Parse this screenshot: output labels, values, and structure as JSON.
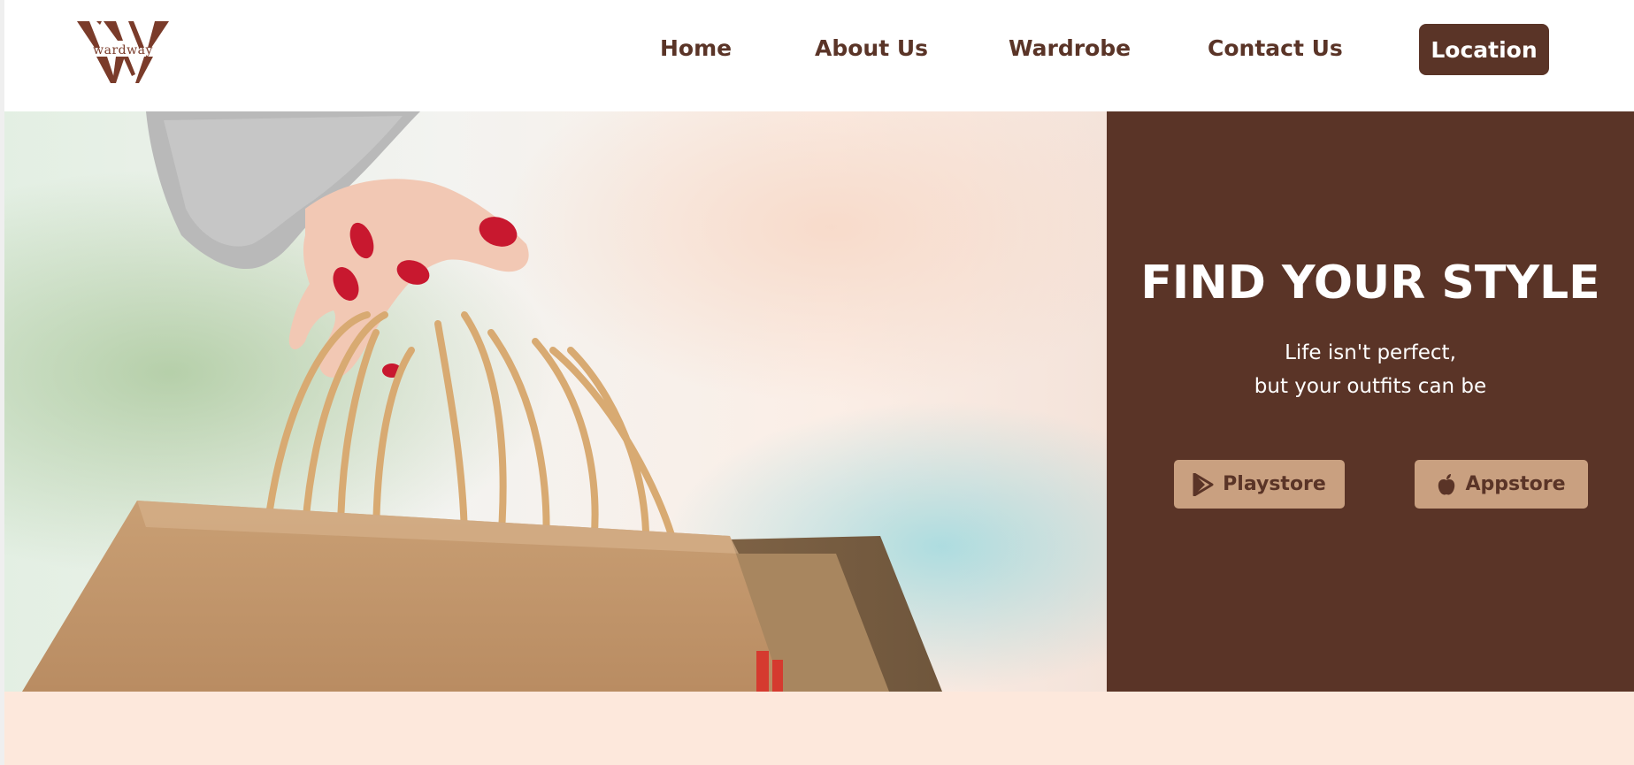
{
  "brand": {
    "logo_text": "wardway",
    "logo_icon": "double-w-logo-icon"
  },
  "nav": {
    "home": "Home",
    "about": "About Us",
    "wardrobe": "Wardrobe",
    "contact": "Contact Us",
    "location": "Location"
  },
  "hero": {
    "image_icon": "shopping-bags-image",
    "title": "FIND YOUR STYLE",
    "subtitle_line1": "Life isn't perfect,",
    "subtitle_line2": "but your outfits can be",
    "playstore_label": "Playstore",
    "appstore_label": "Appstore",
    "playstore_icon": "google-play-icon",
    "appstore_icon": "apple-icon"
  },
  "colors": {
    "primary_brown": "#5a3427",
    "button_tan": "#c9a080",
    "footer_peach": "#fde8dc",
    "white": "#ffffff"
  }
}
